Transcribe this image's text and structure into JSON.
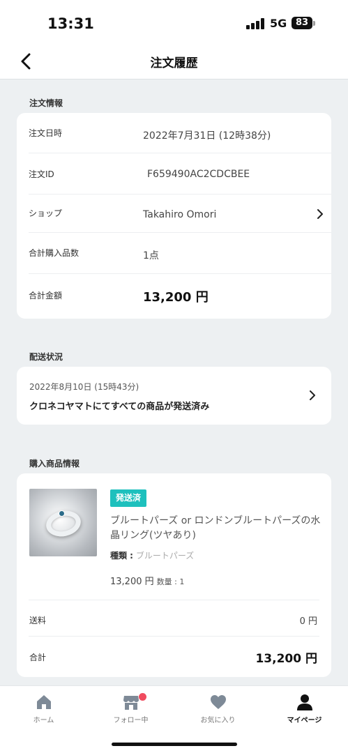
{
  "status_bar": {
    "time": "13:31",
    "network": "5G",
    "battery": "83"
  },
  "nav": {
    "title": "注文履歴",
    "back_icon": "chevron-left-icon"
  },
  "order_info": {
    "section_title": "注文情報",
    "rows": [
      {
        "label": "注文日時",
        "value": "2022年7月31日 (12時38分)"
      },
      {
        "label": "注文ID",
        "value": "F659490AC2CDCBEE"
      },
      {
        "label": "ショップ",
        "value": "Takahiro Omori"
      },
      {
        "label": "合計購入品数",
        "value": "1点"
      },
      {
        "label": "合計金額",
        "value": "13,200 円"
      }
    ]
  },
  "shipping": {
    "section_title": "配送状況",
    "date": "2022年8月10日 (15時43分)",
    "status": "クロネコヤマトにてすべての商品が発送済み"
  },
  "purchased": {
    "section_title": "購入商品情報",
    "badge": "発送済",
    "name": "ブルートパーズ or ロンドンブルートパーズの水晶リング(ツヤあり)",
    "kind_label": "種類 :",
    "kind_value": "ブルートパーズ",
    "price": "13,200 円",
    "quantity": "数量 : 1",
    "shipping_label": "送料",
    "shipping_value": "0 円",
    "total_label": "合計",
    "total_value": "13,200 円"
  },
  "tabs": [
    {
      "label": "ホーム",
      "icon": "home-icon"
    },
    {
      "label": "フォロー中",
      "icon": "store-icon"
    },
    {
      "label": "お気に入り",
      "icon": "heart-icon"
    },
    {
      "label": "マイページ",
      "icon": "person-icon"
    }
  ],
  "colors": {
    "accent": "#1ec0bd",
    "notification": "#f04b5f",
    "background": "#edf0f2"
  }
}
